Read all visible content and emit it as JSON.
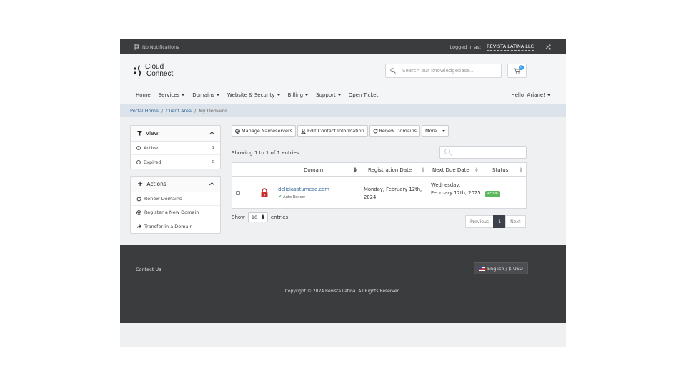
{
  "topbar": {
    "notifications": "No Notifications",
    "logged_in_label": "Logged in as:",
    "account": "REVISTA LATINA LLC"
  },
  "header": {
    "logo_line1": "Cloud",
    "logo_line2": "Connect",
    "search_placeholder": "Search our knowledgebase...",
    "cart_count": "0"
  },
  "nav": {
    "items": [
      "Home",
      "Services",
      "Domains",
      "Website & Security",
      "Billing",
      "Support",
      "Open Ticket"
    ],
    "user": "Hello, Ariane!"
  },
  "breadcrumb": {
    "portal_home": "Portal Home",
    "client_area": "Client Area",
    "current": "My Domains",
    "sep": "/"
  },
  "sidebar": {
    "view": {
      "title": "View",
      "items": [
        {
          "label": "Active",
          "count": "1"
        },
        {
          "label": "Expired",
          "count": "0"
        }
      ]
    },
    "actions": {
      "title": "Actions",
      "items": [
        "Renew Domains",
        "Register a New Domain",
        "Transfer in a Domain"
      ]
    }
  },
  "toolbar": {
    "manage_ns": "Manage Nameservers",
    "edit_contact": "Edit Contact Information",
    "renew": "Renew Domains",
    "more": "More..."
  },
  "table": {
    "showing": "Showing 1 to 1 of 1 entries",
    "columns": [
      "Domain",
      "Registration Date",
      "Next Due Date",
      "Status"
    ],
    "rows": [
      {
        "domain": "deliciasatumesa.com",
        "auto_renew": "Auto Renew",
        "registration": "Monday, February 12th, 2024",
        "due": "Wednesday, February 12th, 2025",
        "status": "Active"
      }
    ],
    "show_label": "Show",
    "page_size": "10",
    "entries_label": "entries",
    "pager": {
      "prev": "Previous",
      "page": "1",
      "next": "Next"
    }
  },
  "footer": {
    "contact": "Contact Us",
    "language": "English / $ USD",
    "copyright": "Copyright © 2024 Revista Latina. All Rights Reserved."
  }
}
